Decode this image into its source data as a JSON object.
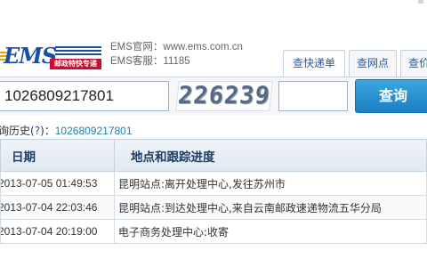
{
  "site": {
    "logo_text": "EMS",
    "logo_cn": "邮政特快专递",
    "website": "EMS官网：www.ems.com.cn",
    "hotline": "EMS客服：11185"
  },
  "tabs": [
    {
      "label": "查快递单",
      "active": true
    },
    {
      "label": "查网点",
      "active": false
    },
    {
      "label": "查价",
      "active": false
    }
  ],
  "search": {
    "tracking_number": "1026809217801",
    "captcha_code": "226239",
    "captcha_value": "",
    "button_label": "查询"
  },
  "history": {
    "label": "询历史(?)：",
    "label_prefix": "询历史(",
    "help": "?",
    "label_suffix": ")：",
    "number": "1026809217801"
  },
  "table": {
    "headers": [
      "日期",
      "地点和跟踪进度"
    ],
    "rows": [
      {
        "date": "2013-07-05 01:49:53",
        "location": "昆明站点:离开处理中心,发往苏州市"
      },
      {
        "date": "2013-07-04 22:03:46",
        "location": "昆明站点:到达处理中心,来自云南邮政速递物流五华分局"
      },
      {
        "date": "2013-07-04 20:19:00",
        "location": "电子商务处理中心:收寄"
      }
    ]
  },
  "colors": {
    "brand_blue": "#1a4fa3",
    "brand_red": "#c8102e",
    "button_blue": "#1c7fc2",
    "link_blue": "#1a7fb5"
  }
}
